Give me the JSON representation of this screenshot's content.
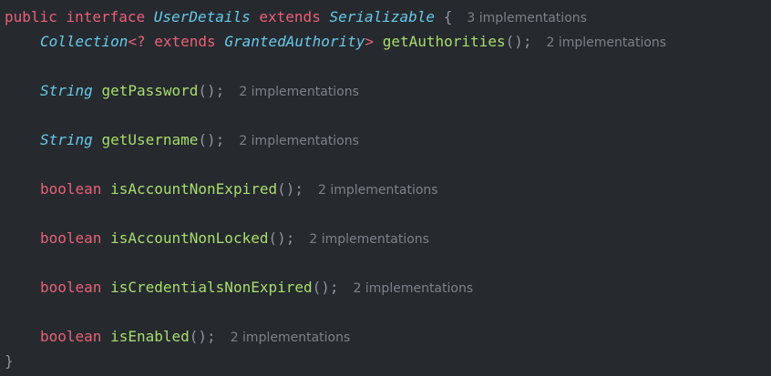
{
  "code": {
    "line1": {
      "kw_public": "public",
      "kw_interface": "interface",
      "name": "UserDetails",
      "kw_extends": "extends",
      "parent": "Serializable",
      "brace": "{",
      "hint": "3 implementations"
    },
    "line2": {
      "type": "Collection",
      "generic_open": "<?",
      "kw_extends": "extends",
      "generic_type": "GrantedAuthority",
      "generic_close": ">",
      "method": "getAuthorities",
      "parens": "();",
      "hint": "2 implementations"
    },
    "line3": {
      "type": "String",
      "method": "getPassword",
      "parens": "();",
      "hint": "2 implementations"
    },
    "line4": {
      "type": "String",
      "method": "getUsername",
      "parens": "();",
      "hint": "2 implementations"
    },
    "line5": {
      "type": "boolean",
      "method": "isAccountNonExpired",
      "parens": "();",
      "hint": "2 implementations"
    },
    "line6": {
      "type": "boolean",
      "method": "isAccountNonLocked",
      "parens": "();",
      "hint": "2 implementations"
    },
    "line7": {
      "type": "boolean",
      "method": "isCredentialsNonExpired",
      "parens": "();",
      "hint": "2 implementations"
    },
    "line8": {
      "type": "boolean",
      "method": "isEnabled",
      "parens": "();",
      "hint": "2 implementations"
    },
    "line9": {
      "brace": "}"
    }
  },
  "colors": {
    "background": "#262a2f",
    "keyword": "#ec5f75",
    "type": "#66c9e8",
    "method": "#a8dd6c",
    "punctuation": "#8e949d",
    "inlay_hint": "#7c8188"
  }
}
